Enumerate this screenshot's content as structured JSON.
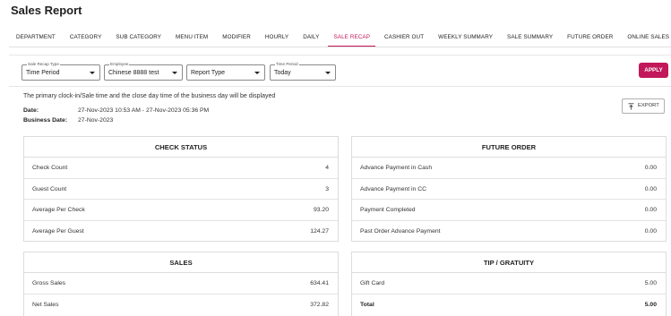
{
  "page": {
    "title": "Sales Report"
  },
  "tabs": [
    {
      "label": "DEPARTMENT",
      "active": false
    },
    {
      "label": "CATEGORY",
      "active": false
    },
    {
      "label": "SUB CATEGORY",
      "active": false
    },
    {
      "label": "MENU ITEM",
      "active": false
    },
    {
      "label": "MODIFIER",
      "active": false
    },
    {
      "label": "HOURLY",
      "active": false
    },
    {
      "label": "DAILY",
      "active": false
    },
    {
      "label": "SALE RECAP",
      "active": true
    },
    {
      "label": "CASHIER OUT",
      "active": false
    },
    {
      "label": "WEEKLY SUMMARY",
      "active": false
    },
    {
      "label": "SALE SUMMARY",
      "active": false
    },
    {
      "label": "FUTURE ORDER",
      "active": false
    },
    {
      "label": "ONLINE SALES",
      "active": false
    }
  ],
  "filters": {
    "recap_type": {
      "label": "Sale Recap Type",
      "value": "Time Period"
    },
    "employee": {
      "label": "Employee",
      "value": "Chinese 8888 test"
    },
    "report_type": {
      "label": "",
      "value": "Report Type"
    },
    "time_period": {
      "label": "Time Period",
      "value": "Today"
    },
    "apply_label": "APPLY"
  },
  "info": {
    "note": "The primary clock-in/Sale time and the close day time of the business day will be displayed",
    "date_label": "Date:",
    "date_value": "27-Nov-2023 10:53 AM - 27-Nov-2023 05:36 PM",
    "business_date_label": "Business Date:",
    "business_date_value": "27-Nov-2023"
  },
  "export_label": "EXPORT",
  "colors": {
    "accent": "#c2185b"
  },
  "icons": {
    "export": "export-icon"
  },
  "cards": {
    "check_status": {
      "title": "CHECK STATUS",
      "rows": [
        {
          "label": "Check Count",
          "value": "4"
        },
        {
          "label": "Guest Count",
          "value": "3"
        },
        {
          "label": "Average Per Check",
          "value": "93.20"
        },
        {
          "label": "Average Per Guest",
          "value": "124.27"
        }
      ]
    },
    "future_order": {
      "title": "FUTURE ORDER",
      "rows": [
        {
          "label": "Advance Payment in Cash",
          "value": "0.00"
        },
        {
          "label": "Advance Payment in CC",
          "value": "0.00"
        },
        {
          "label": "Payment Completed",
          "value": "0.00"
        },
        {
          "label": "Past Order Advance Payment",
          "value": "0.00"
        }
      ]
    },
    "sales": {
      "title": "SALES",
      "rows": [
        {
          "label": "Gross Sales",
          "value": "634.41"
        },
        {
          "label": "Net Sales",
          "value": "372.82"
        }
      ]
    },
    "tip": {
      "title": "TIP / GRATUITY",
      "rows": [
        {
          "label": "Gift Card",
          "value": "5.00"
        },
        {
          "label": "Total",
          "value": "5.00"
        }
      ]
    }
  }
}
